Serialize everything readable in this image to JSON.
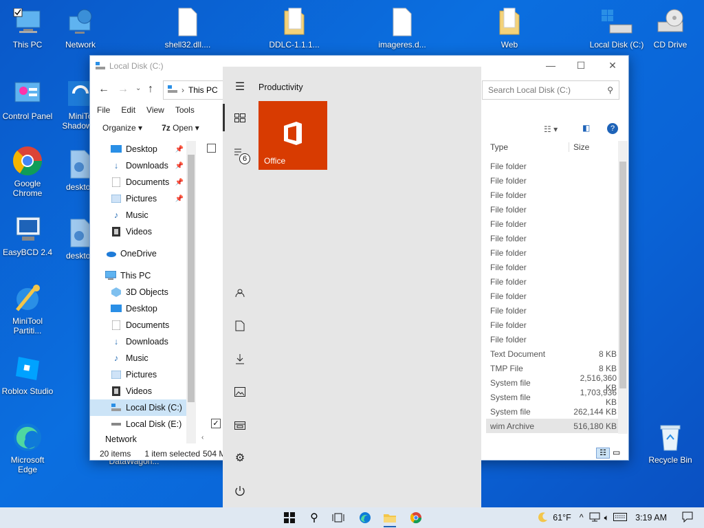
{
  "desktop": {
    "icons": [
      {
        "label": "This PC"
      },
      {
        "label": "Network"
      },
      {
        "label": "shell32.dll...."
      },
      {
        "label": "DDLC-1.1.1..."
      },
      {
        "label": "imageres.d..."
      },
      {
        "label": "Web"
      },
      {
        "label": "Local Disk (C:)"
      },
      {
        "label": "CD Drive"
      },
      {
        "label": "Control Panel"
      },
      {
        "label": "MiniTo ShadowM"
      },
      {
        "label": "Google Chrome"
      },
      {
        "label": "desktop"
      },
      {
        "label": "EasyBCD 2.4"
      },
      {
        "label": "desktop"
      },
      {
        "label": "MiniTool Partiti..."
      },
      {
        "label": "Roblox Studio"
      },
      {
        "label": "Microsoft Edge"
      },
      {
        "label": "DataWagon..."
      },
      {
        "label": "Recycle Bin"
      }
    ]
  },
  "explorer": {
    "title": "Local Disk (C:)",
    "address": "This PC",
    "search_placeholder": "Search Local Disk (C:)",
    "menu": [
      "File",
      "Edit",
      "View",
      "Tools"
    ],
    "toolbar": {
      "organize": "Organize",
      "open": "Open"
    },
    "nav": {
      "quick": [
        {
          "label": "Desktop"
        },
        {
          "label": "Downloads"
        },
        {
          "label": "Documents"
        },
        {
          "label": "Pictures"
        },
        {
          "label": "Music"
        },
        {
          "label": "Videos"
        }
      ],
      "onedrive": "OneDrive",
      "thispc": "This PC",
      "pc_items": [
        {
          "label": "3D Objects"
        },
        {
          "label": "Desktop"
        },
        {
          "label": "Documents"
        },
        {
          "label": "Downloads"
        },
        {
          "label": "Music"
        },
        {
          "label": "Pictures"
        },
        {
          "label": "Videos"
        },
        {
          "label": "Local Disk (C:)"
        },
        {
          "label": "Local Disk (E:)"
        }
      ],
      "network": "Network"
    },
    "columns": {
      "type": "Type",
      "size": "Size"
    },
    "rows": [
      {
        "type": "File folder",
        "size": ""
      },
      {
        "type": "File folder",
        "size": ""
      },
      {
        "type": "File folder",
        "size": ""
      },
      {
        "type": "File folder",
        "size": ""
      },
      {
        "type": "File folder",
        "size": ""
      },
      {
        "type": "File folder",
        "size": ""
      },
      {
        "type": "File folder",
        "size": ""
      },
      {
        "type": "File folder",
        "size": ""
      },
      {
        "type": "File folder",
        "size": ""
      },
      {
        "type": "File folder",
        "size": ""
      },
      {
        "type": "File folder",
        "size": ""
      },
      {
        "type": "File folder",
        "size": ""
      },
      {
        "type": "File folder",
        "size": ""
      },
      {
        "type": "Text Document",
        "size": "8 KB"
      },
      {
        "type": "TMP File",
        "size": "8 KB"
      },
      {
        "type": "System file",
        "size": "2,516,360 KB"
      },
      {
        "type": "System file",
        "size": "1,703,936 KB"
      },
      {
        "type": "System file",
        "size": "262,144 KB"
      },
      {
        "type": "wim Archive",
        "size": "516,180 KB"
      }
    ],
    "status": {
      "items": "20 items",
      "selected": "1 item selected",
      "size": "504 M"
    }
  },
  "start": {
    "group_title": "Productivity",
    "tile_label": "Office",
    "badge": "6"
  },
  "taskbar": {
    "weather": "61°F",
    "time": "3:19 AM"
  }
}
